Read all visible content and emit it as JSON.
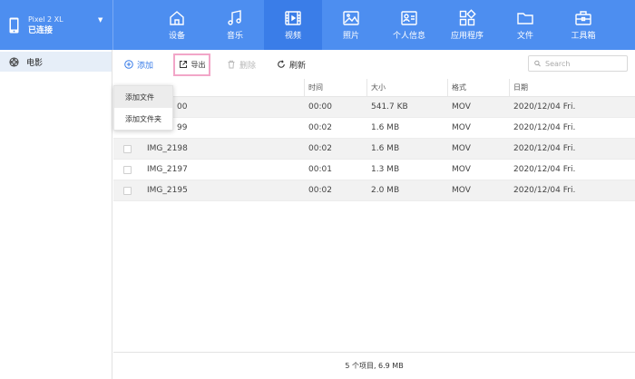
{
  "device": {
    "model": "Pixel 2 XL",
    "status": "已连接"
  },
  "nav": [
    {
      "label": "设备",
      "icon": "home-icon"
    },
    {
      "label": "音乐",
      "icon": "music-icon"
    },
    {
      "label": "视频",
      "icon": "video-icon",
      "active": true
    },
    {
      "label": "照片",
      "icon": "photo-icon"
    },
    {
      "label": "个人信息",
      "icon": "contact-card-icon"
    },
    {
      "label": "应用程序",
      "icon": "apps-icon"
    },
    {
      "label": "文件",
      "icon": "folder-icon"
    },
    {
      "label": "工具箱",
      "icon": "toolbox-icon"
    }
  ],
  "sidebar": {
    "items": [
      {
        "label": "电影",
        "icon": "film-reel-icon"
      }
    ]
  },
  "toolbar": {
    "add": "添加",
    "export": "导出",
    "delete": "删除",
    "refresh": "刷新"
  },
  "search": {
    "placeholder": "Search"
  },
  "table": {
    "headers": {
      "time": "时间",
      "size": "大小",
      "format": "格式",
      "date": "日期"
    },
    "rows": [
      {
        "name": "IMG_2200",
        "time": "00:00",
        "size": "541.7 KB",
        "format": "MOV",
        "date": "2020/12/04 Fri."
      },
      {
        "name": "IMG_2199",
        "time": "00:02",
        "size": "1.6 MB",
        "format": "MOV",
        "date": "2020/12/04 Fri."
      },
      {
        "name": "IMG_2198",
        "time": "00:02",
        "size": "1.6 MB",
        "format": "MOV",
        "date": "2020/12/04 Fri."
      },
      {
        "name": "IMG_2197",
        "time": "00:01",
        "size": "1.3 MB",
        "format": "MOV",
        "date": "2020/12/04 Fri."
      },
      {
        "name": "IMG_2195",
        "time": "00:02",
        "size": "2.0 MB",
        "format": "MOV",
        "date": "2020/12/04 Fri."
      }
    ],
    "visible_row_name_tails": [
      "00",
      "99"
    ]
  },
  "dropdown": {
    "items": [
      "添加文件",
      "添加文件夹"
    ]
  },
  "footer": {
    "summary": "5 个项目, 6.9 MB"
  },
  "colors": {
    "topbar": "#4d8ef0",
    "nav_active": "#3a7de8",
    "accent": "#3a7de8",
    "highlight_border": "#f2a6c8",
    "sidebar_selected": "#e6eef8"
  }
}
